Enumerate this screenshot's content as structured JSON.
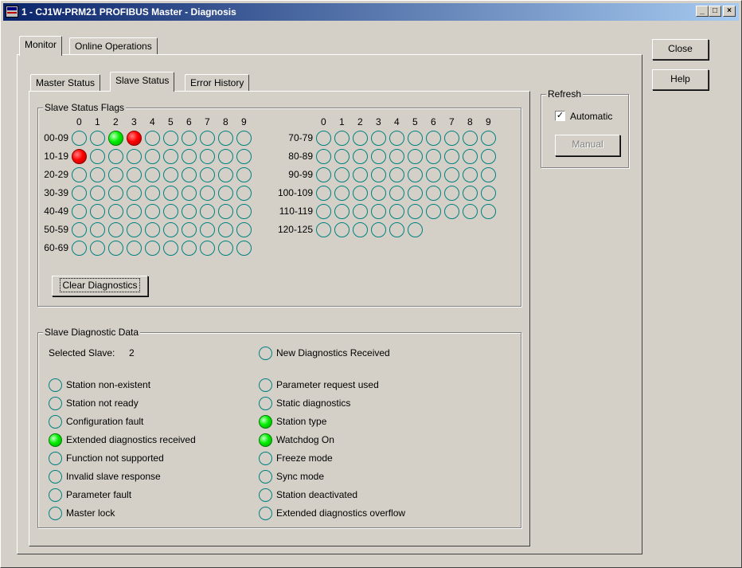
{
  "window": {
    "title": "1 - CJ1W-PRM21 PROFIBUS Master - Diagnosis",
    "minimize_glyph": "_",
    "maximize_glyph": "□",
    "close_glyph": "×"
  },
  "tabs_outer": [
    "Monitor",
    "Online Operations"
  ],
  "tabs_inner": [
    "Master Status",
    "Slave Status",
    "Error History"
  ],
  "buttons": {
    "close": "Close",
    "help": "Help",
    "clear": "Clear Diagnostics",
    "manual": "Manual"
  },
  "refresh": {
    "title": "Refresh",
    "automatic_label": "Automatic",
    "automatic_checked": true,
    "check_glyph": "✓"
  },
  "flags": {
    "title": "Slave Status Flags",
    "column_headers": [
      "0",
      "1",
      "2",
      "3",
      "4",
      "5",
      "6",
      "7",
      "8",
      "9"
    ],
    "left_rows": [
      {
        "label": "00-09",
        "states": [
          "off",
          "off",
          "green",
          "red",
          "off",
          "off",
          "off",
          "off",
          "off",
          "off"
        ]
      },
      {
        "label": "10-19",
        "states": [
          "red",
          "off",
          "off",
          "off",
          "off",
          "off",
          "off",
          "off",
          "off",
          "off"
        ]
      },
      {
        "label": "20-29",
        "states": [
          "off",
          "off",
          "off",
          "off",
          "off",
          "off",
          "off",
          "off",
          "off",
          "off"
        ]
      },
      {
        "label": "30-39",
        "states": [
          "off",
          "off",
          "off",
          "off",
          "off",
          "off",
          "off",
          "off",
          "off",
          "off"
        ]
      },
      {
        "label": "40-49",
        "states": [
          "off",
          "off",
          "off",
          "off",
          "off",
          "off",
          "off",
          "off",
          "off",
          "off"
        ]
      },
      {
        "label": "50-59",
        "states": [
          "off",
          "off",
          "off",
          "off",
          "off",
          "off",
          "off",
          "off",
          "off",
          "off"
        ]
      },
      {
        "label": "60-69",
        "states": [
          "off",
          "off",
          "off",
          "off",
          "off",
          "off",
          "off",
          "off",
          "off",
          "off"
        ]
      }
    ],
    "right_rows": [
      {
        "label": "70-79",
        "states": [
          "off",
          "off",
          "off",
          "off",
          "off",
          "off",
          "off",
          "off",
          "off",
          "off"
        ]
      },
      {
        "label": "80-89",
        "states": [
          "off",
          "off",
          "off",
          "off",
          "off",
          "off",
          "off",
          "off",
          "off",
          "off"
        ]
      },
      {
        "label": "90-99",
        "states": [
          "off",
          "off",
          "off",
          "off",
          "off",
          "off",
          "off",
          "off",
          "off",
          "off"
        ]
      },
      {
        "label": "100-109",
        "states": [
          "off",
          "off",
          "off",
          "off",
          "off",
          "off",
          "off",
          "off",
          "off",
          "off"
        ]
      },
      {
        "label": "110-119",
        "states": [
          "off",
          "off",
          "off",
          "off",
          "off",
          "off",
          "off",
          "off",
          "off",
          "off"
        ]
      },
      {
        "label": "120-125",
        "states": [
          "off",
          "off",
          "off",
          "off",
          "off",
          "off"
        ]
      }
    ]
  },
  "diag": {
    "title": "Slave Diagnostic Data",
    "selected_label": "Selected Slave:",
    "selected_value": "2",
    "new_diag": {
      "label": "New Diagnostics Received",
      "state": "off"
    },
    "left": [
      {
        "label": "Station non-existent",
        "state": "off"
      },
      {
        "label": "Station not ready",
        "state": "off"
      },
      {
        "label": "Configuration fault",
        "state": "off"
      },
      {
        "label": "Extended diagnostics received",
        "state": "green"
      },
      {
        "label": "Function not supported",
        "state": "off"
      },
      {
        "label": "Invalid slave response",
        "state": "off"
      },
      {
        "label": "Parameter fault",
        "state": "off"
      },
      {
        "label": "Master lock",
        "state": "off"
      }
    ],
    "right": [
      {
        "label": "Parameter request used",
        "state": "off"
      },
      {
        "label": "Static diagnostics",
        "state": "off"
      },
      {
        "label": "Station type",
        "state": "green"
      },
      {
        "label": "Watchdog On",
        "state": "green"
      },
      {
        "label": "Freeze mode",
        "state": "off"
      },
      {
        "label": "Sync mode",
        "state": "off"
      },
      {
        "label": "Station deactivated",
        "state": "off"
      },
      {
        "label": "Extended diagnostics overflow",
        "state": "off"
      }
    ]
  }
}
